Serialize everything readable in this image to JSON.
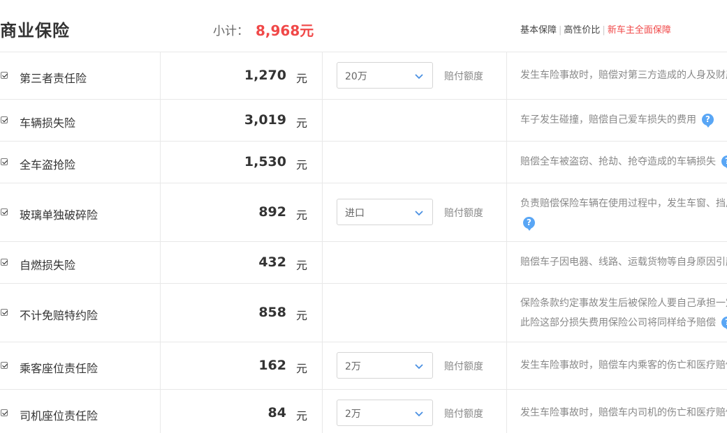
{
  "header": {
    "title": "商业保险",
    "subtotal_label": "小计：",
    "subtotal_value": "8,968元",
    "links": [
      "基本保障",
      "高性价比",
      "新车主全面保障"
    ]
  },
  "colors": {
    "accent_red": "#f04848",
    "help_blue": "#59a6f5"
  },
  "unit": "元",
  "claim_label": "赔付额度",
  "rows": [
    {
      "name": "第三者责任险",
      "price": "1,270",
      "select": "20万",
      "desc1": "发生车险事故时，赔偿对第三方造成的人身及财产"
    },
    {
      "name": "车辆损失险",
      "price": "3,019",
      "desc1": "车子发生碰撞，赔偿自己爱车损失的费用"
    },
    {
      "name": "全车盗抢险",
      "price": "1,530",
      "desc1": "赔偿全车被盗窃、抢劫、抢夺造成的车辆损失"
    },
    {
      "name": "玻璃单独破碎险",
      "price": "892",
      "select": "进口",
      "desc1": "负责赔偿保险车辆在使用过程中，发生车窗、挡风"
    },
    {
      "name": "自燃损失险",
      "price": "432",
      "desc1": "赔偿车子因电器、线路、运载货物等自身原因引起"
    },
    {
      "name": "不计免赔特约险",
      "price": "858",
      "desc1": "保险条款约定事故发生后被保险人要自己承担一定",
      "desc2": "此险这部分损失费用保险公司将同样给予赔偿"
    },
    {
      "name": "乘客座位责任险",
      "price": "162",
      "select": "2万",
      "desc1": "发生车险事故时，赔偿车内乘客的伤亡和医疗赔偿"
    },
    {
      "name": "司机座位责任险",
      "price": "84",
      "select": "2万",
      "desc1": "发生车险事故时，赔偿车内司机的伤亡和医疗赔偿"
    }
  ]
}
